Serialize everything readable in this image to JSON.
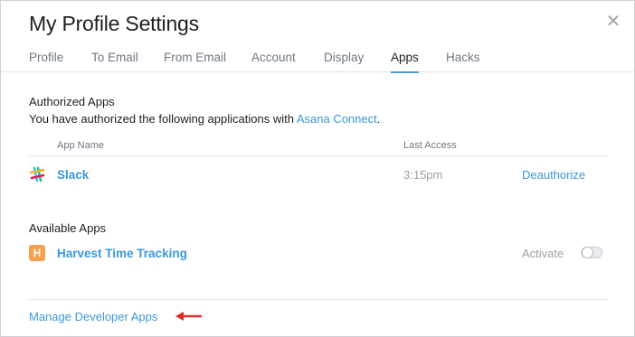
{
  "dialog": {
    "title": "My Profile Settings",
    "close_icon": "close-icon"
  },
  "tabs": [
    {
      "label": "Profile",
      "active": false
    },
    {
      "label": "To Email",
      "active": false
    },
    {
      "label": "From Email",
      "active": false
    },
    {
      "label": "Account",
      "active": false
    },
    {
      "label": "Display",
      "active": false
    },
    {
      "label": "Apps",
      "active": true
    },
    {
      "label": "Hacks",
      "active": false
    }
  ],
  "authorized": {
    "title": "Authorized Apps",
    "desc_prefix": "You have authorized the following applications with ",
    "desc_link": "Asana Connect",
    "desc_suffix": ".",
    "columns": {
      "app_name": "App Name",
      "last_access": "Last Access"
    },
    "apps": [
      {
        "name": "Slack",
        "icon": "slack-icon",
        "last_access": "3:15pm",
        "action": "Deauthorize"
      }
    ]
  },
  "available": {
    "title": "Available Apps",
    "apps": [
      {
        "name": "Harvest Time Tracking",
        "icon": "harvest-icon",
        "icon_letter": "H",
        "action": "Activate",
        "enabled": false
      }
    ]
  },
  "footer": {
    "manage_link": "Manage Developer Apps",
    "annotation_icon": "red-arrow-icon"
  },
  "colors": {
    "accent": "#3b98d8",
    "harvest": "#f4a04c",
    "arrow": "#e32b2b"
  }
}
